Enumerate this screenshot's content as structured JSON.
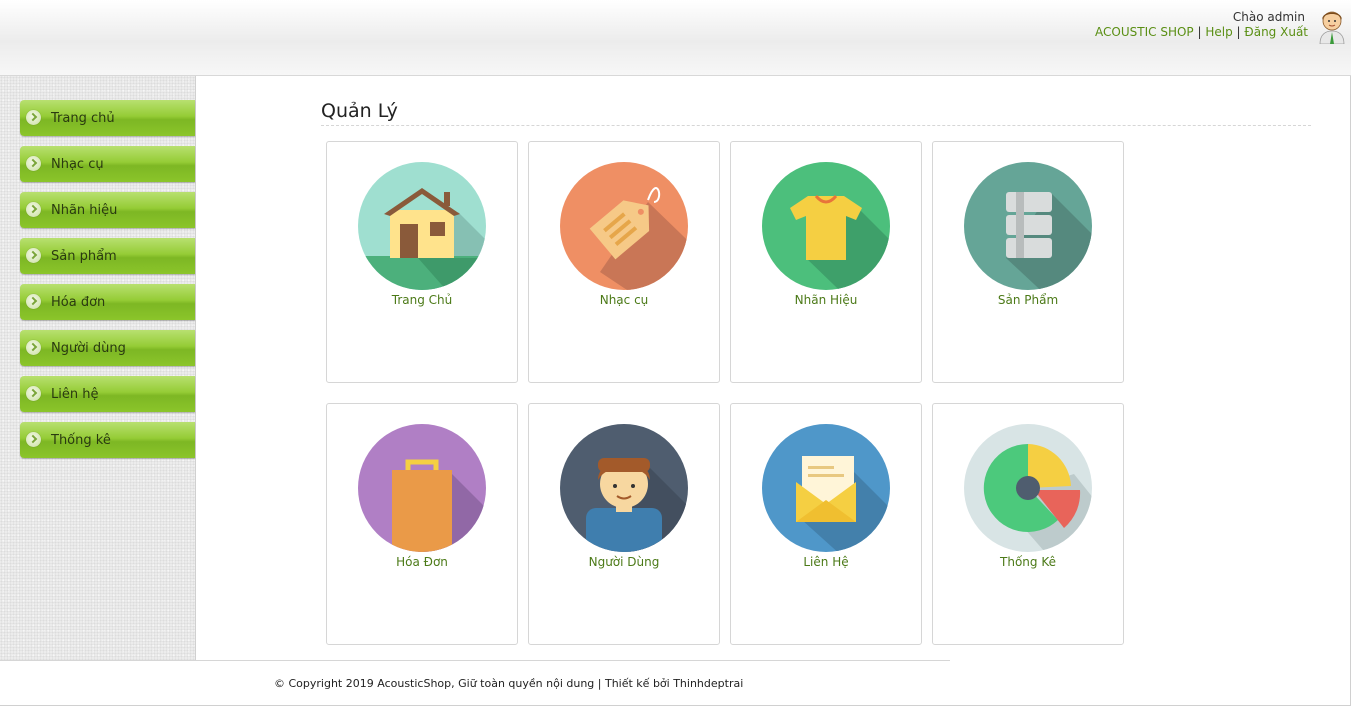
{
  "header": {
    "greeting": "Chào admin",
    "links": [
      "ACOUSTIC SHOP",
      "Help",
      "Đăng Xuất"
    ],
    "separator": "|",
    "link_color": "#5a8f14"
  },
  "sidebar": {
    "accent": "#8bc52a",
    "items": [
      {
        "label": "Trang chủ"
      },
      {
        "label": "Nhạc cụ"
      },
      {
        "label": "Nhãn hiệu"
      },
      {
        "label": "Sản phẩm"
      },
      {
        "label": "Hóa đơn"
      },
      {
        "label": "Người dùng"
      },
      {
        "label": "Liên hệ"
      },
      {
        "label": "Thống kê"
      }
    ]
  },
  "main": {
    "title": "Quản Lý",
    "cards": [
      {
        "label": "Trang Chủ",
        "icon": "home-icon",
        "color": "#9fdfd0"
      },
      {
        "label": "Nhạc cụ",
        "icon": "tag-icon",
        "color": "#ef8f64"
      },
      {
        "label": "Nhãn Hiệu",
        "icon": "tshirt-icon",
        "color": "#4cbf7c"
      },
      {
        "label": "Sản Phẩm",
        "icon": "database-icon",
        "color": "#65a597"
      },
      {
        "label": "Hóa Đơn",
        "icon": "shopping-bag-icon",
        "color": "#b07fc5"
      },
      {
        "label": "Người Dùng",
        "icon": "user-icon",
        "color": "#4f5d6f"
      },
      {
        "label": "Liên Hệ",
        "icon": "mail-icon",
        "color": "#4f97c9"
      },
      {
        "label": "Thống Kê",
        "icon": "pie-chart-icon",
        "color": "#d8e4e5"
      }
    ]
  },
  "footer": {
    "text": "© Copyright 2019 AcousticShop, Giữ toàn quyền nội dung | Thiết kế bởi Thinhdeptrai"
  }
}
